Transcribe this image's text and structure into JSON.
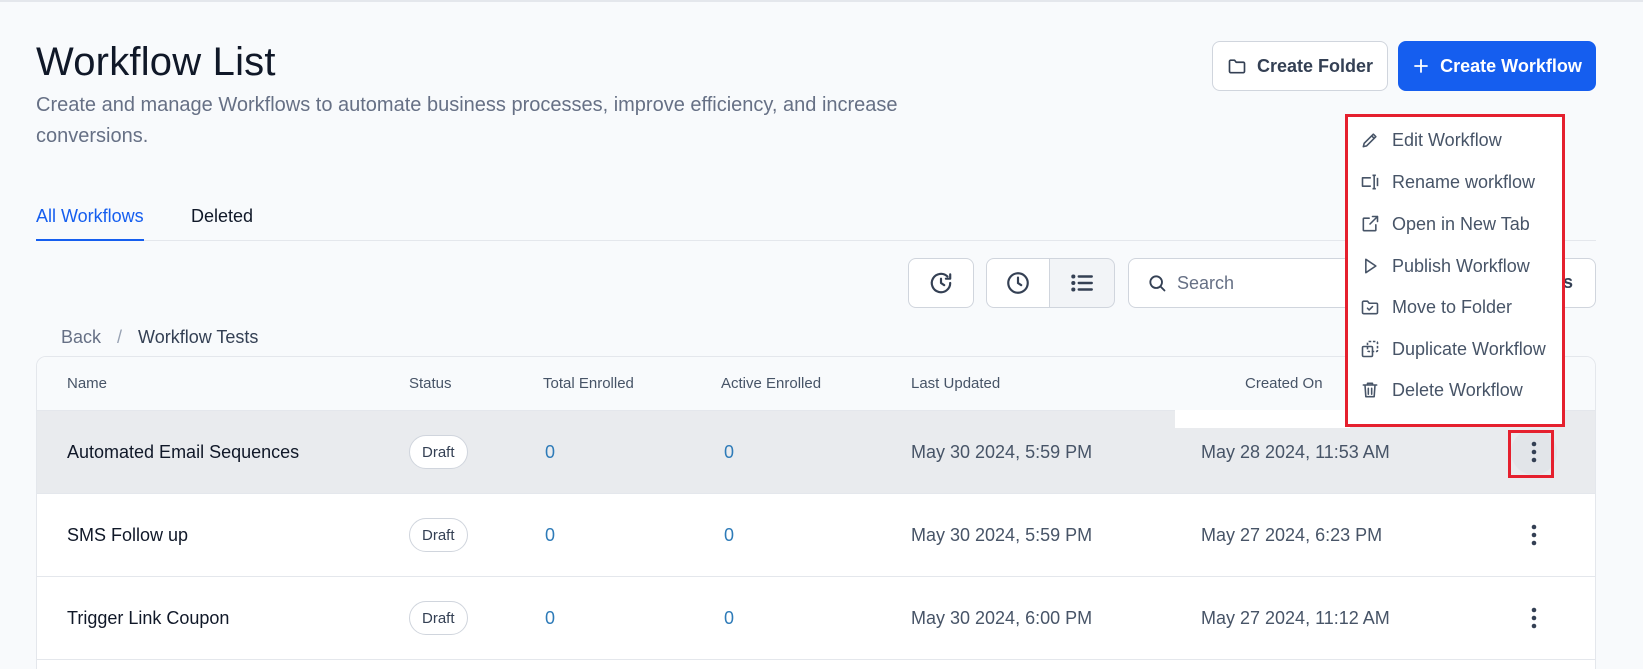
{
  "page": {
    "title": "Workflow List",
    "description": "Create and manage Workflows to automate business processes, improve efficiency, and increase conversions."
  },
  "header_actions": {
    "create_folder": "Create Folder",
    "create_workflow": "Create Workflow"
  },
  "tabs": [
    {
      "label": "All Workflows",
      "active": true
    },
    {
      "label": "Deleted",
      "active": false
    }
  ],
  "toolbar": {
    "search_placeholder": "Search",
    "truncated_right_label": "s"
  },
  "breadcrumb": {
    "back": "Back",
    "separator": "/",
    "current": "Workflow Tests"
  },
  "table": {
    "columns": [
      "Name",
      "Status",
      "Total Enrolled",
      "Active Enrolled",
      "Last Updated",
      "Created On"
    ],
    "rows": [
      {
        "name": "Automated Email Sequences",
        "status": "Draft",
        "total_enrolled": "0",
        "active_enrolled": "0",
        "last_updated": "May 30 2024, 5:59 PM",
        "created_on": "May 28 2024, 11:53 AM"
      },
      {
        "name": "SMS Follow up",
        "status": "Draft",
        "total_enrolled": "0",
        "active_enrolled": "0",
        "last_updated": "May 30 2024, 5:59 PM",
        "created_on": "May 27 2024, 6:23 PM"
      },
      {
        "name": "Trigger Link Coupon",
        "status": "Draft",
        "total_enrolled": "0",
        "active_enrolled": "0",
        "last_updated": "May 30 2024, 6:00 PM",
        "created_on": "May 27 2024, 11:12 AM"
      }
    ]
  },
  "context_menu": {
    "items": [
      {
        "label": "Edit Workflow",
        "icon": "pencil-icon"
      },
      {
        "label": "Rename workflow",
        "icon": "rename-icon"
      },
      {
        "label": "Open in New Tab",
        "icon": "external-link-icon"
      },
      {
        "label": "Publish Workflow",
        "icon": "play-icon"
      },
      {
        "label": "Move to Folder",
        "icon": "folder-check-icon"
      },
      {
        "label": "Duplicate Workflow",
        "icon": "duplicate-icon"
      },
      {
        "label": "Delete Workflow",
        "icon": "trash-icon"
      }
    ]
  },
  "colors": {
    "primary": "#155eef",
    "highlight_border": "#e5202e",
    "link_number": "#2e7bb8"
  }
}
